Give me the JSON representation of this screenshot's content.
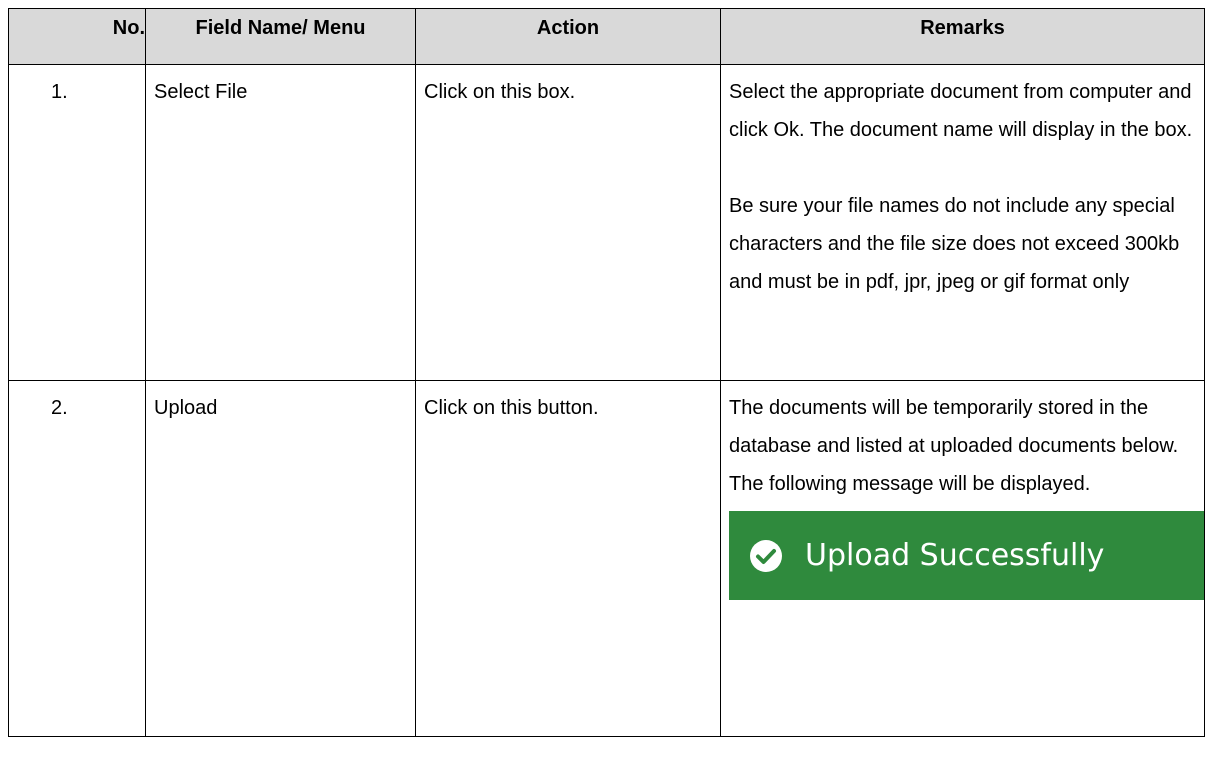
{
  "table": {
    "headers": {
      "no": "No.",
      "field": "Field Name/ Menu",
      "action": "Action",
      "remarks": "Remarks"
    },
    "rows": [
      {
        "no": "1.",
        "field": "Select File",
        "action": "Click on this box.",
        "remarks": [
          "Select the appropriate document from computer and click Ok. The document name will display in the box.",
          "Be sure your file names do not include any special characters and the file size does not exceed 300kb and must be in pdf, jpr, jpeg or gif format only"
        ]
      },
      {
        "no": "2.",
        "field": "Upload",
        "action": "Click on this button.",
        "remarks": [
          "The documents will be temporarily stored in the database and listed at uploaded documents below. The following message will be displayed."
        ],
        "banner": {
          "icon": "check-circle-icon",
          "text": "Upload Successfully",
          "color": "#2f8a3d"
        }
      }
    ]
  }
}
